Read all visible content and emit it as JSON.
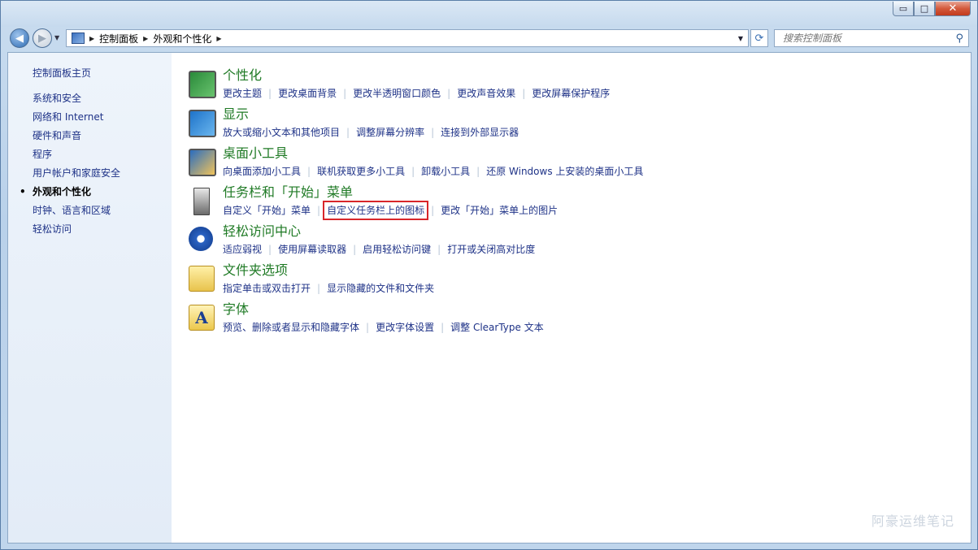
{
  "window": {
    "caption_buttons": {
      "minimize": "▭",
      "maximize": "□",
      "close": "✕"
    }
  },
  "nav": {
    "back_icon": "back-arrow-icon",
    "forward_icon": "forward-arrow-icon",
    "breadcrumb": [
      "控制面板",
      "外观和个性化"
    ],
    "search_placeholder": "搜索控制面板"
  },
  "sidebar": {
    "home": "控制面板主页",
    "items": [
      {
        "label": "系统和安全",
        "current": false
      },
      {
        "label": "网络和 Internet",
        "current": false
      },
      {
        "label": "硬件和声音",
        "current": false
      },
      {
        "label": "程序",
        "current": false
      },
      {
        "label": "用户帐户和家庭安全",
        "current": false
      },
      {
        "label": "外观和个性化",
        "current": true
      },
      {
        "label": "时钟、语言和区域",
        "current": false
      },
      {
        "label": "轻松访问",
        "current": false
      }
    ]
  },
  "categories": [
    {
      "title": "个性化",
      "icon": "personalization-icon",
      "links": [
        "更改主题",
        "更改桌面背景",
        "更改半透明窗口颜色",
        "更改声音效果",
        "更改屏幕保护程序"
      ]
    },
    {
      "title": "显示",
      "icon": "display-icon",
      "links": [
        "放大或缩小文本和其他项目",
        "调整屏幕分辨率",
        "连接到外部显示器"
      ]
    },
    {
      "title": "桌面小工具",
      "icon": "gadgets-icon",
      "links": [
        "向桌面添加小工具",
        "联机获取更多小工具",
        "卸载小工具",
        "还原 Windows 上安装的桌面小工具"
      ]
    },
    {
      "title": "任务栏和「开始」菜单",
      "icon": "taskbar-icon",
      "links": [
        "自定义「开始」菜单",
        "自定义任务栏上的图标",
        "更改「开始」菜单上的图片"
      ]
    },
    {
      "title": "轻松访问中心",
      "icon": "ease-of-access-icon",
      "links": [
        "适应弱视",
        "使用屏幕读取器",
        "启用轻松访问键",
        "打开或关闭高对比度"
      ]
    },
    {
      "title": "文件夹选项",
      "icon": "folder-options-icon",
      "links": [
        "指定单击或双击打开",
        "显示隐藏的文件和文件夹"
      ]
    },
    {
      "title": "字体",
      "icon": "fonts-icon",
      "links": [
        "预览、删除或者显示和隐藏字体",
        "更改字体设置",
        "调整 ClearType 文本"
      ]
    }
  ],
  "highlight_color": "#d8262a",
  "watermark": "阿豪运维笔记"
}
